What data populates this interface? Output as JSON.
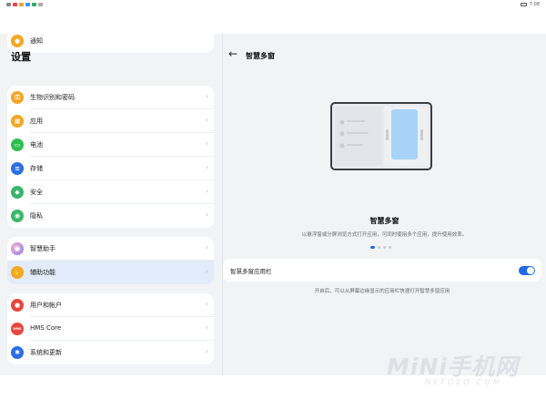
{
  "status_bar": {
    "time": "7:08"
  },
  "left": {
    "title": "设置",
    "partial_item": "通知",
    "cards": [
      {
        "items": [
          {
            "label": "生物识别和密码",
            "icon": "key-icon",
            "color": "#f4a52a"
          },
          {
            "label": "应用",
            "icon": "apps-icon",
            "color": "#f5a623"
          },
          {
            "label": "电池",
            "icon": "battery-icon",
            "color": "#2fbf4f"
          },
          {
            "label": "存储",
            "icon": "storage-icon",
            "color": "#2b6fe5"
          },
          {
            "label": "安全",
            "icon": "shield-icon",
            "color": "#38b56a"
          },
          {
            "label": "隐私",
            "icon": "privacy-icon",
            "color": "#3bb86a"
          }
        ]
      },
      {
        "items": [
          {
            "label": "智慧助手",
            "icon": "assistant-icon",
            "color": "#9b7ee6"
          },
          {
            "label": "辅助功能",
            "icon": "hand-icon",
            "color": "#f5a623"
          }
        ]
      },
      {
        "items": [
          {
            "label": "用户和帐户",
            "icon": "user-icon",
            "color": "#e9463b"
          },
          {
            "label": "HMS Core",
            "icon": "hms-icon",
            "color": "#e9463b",
            "icon_text": "HMS"
          },
          {
            "label": "系统和更新",
            "icon": "gear-icon",
            "color": "#2b6fe5"
          }
        ]
      }
    ]
  },
  "right": {
    "title": "智慧多窗",
    "feature_title": "智慧多窗",
    "feature_desc": "以悬浮窗或分屏浏览方式打开应用，可同时使用多个应用，提升使用效率。",
    "toggle_label": "智慧多窗应用栏",
    "toggle_on": true,
    "toggle_hint": "开启后，可以从屏幕边缘显示的应用栏快速打开智慧多窗应用",
    "accent": "#1e6be6"
  },
  "watermark": {
    "text": "MiNi手机网",
    "sub": "NETOEO.COM"
  }
}
